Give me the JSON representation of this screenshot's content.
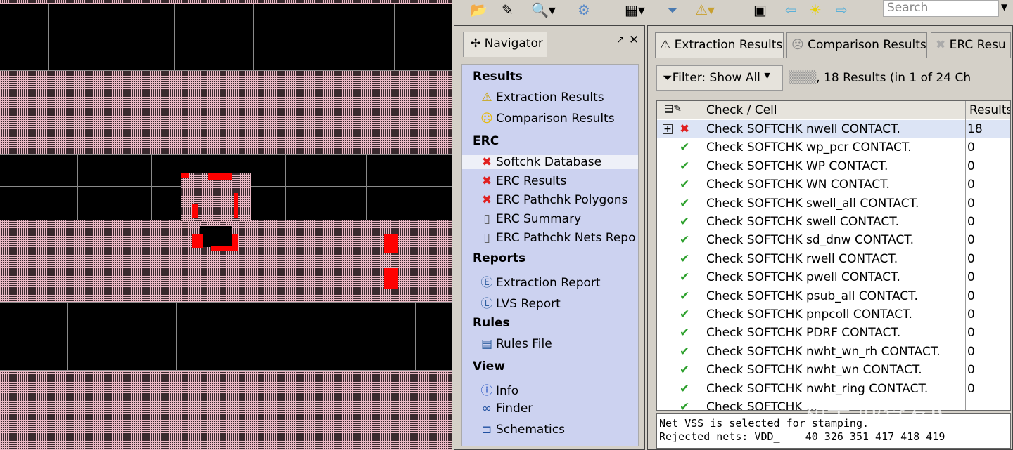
{
  "toolbar": {
    "search_placeholder": "Search"
  },
  "navigator": {
    "tab_label": "Navigator",
    "sections": [
      {
        "title": "Results",
        "items": [
          {
            "icon": "extraction-icon",
            "label": "Extraction Results"
          },
          {
            "icon": "sad-face-icon",
            "label": "Comparison Results"
          }
        ]
      },
      {
        "title": "ERC",
        "items": [
          {
            "icon": "red-x-icon",
            "label": "Softchk Database"
          },
          {
            "icon": "red-x-icon",
            "label": "ERC Results"
          },
          {
            "icon": "red-x-icon",
            "label": "ERC Pathchk Polygons"
          },
          {
            "icon": "document-icon",
            "label": "ERC Summary"
          },
          {
            "icon": "document-icon",
            "label": "ERC Pathchk Nets Repo"
          }
        ]
      },
      {
        "title": "Reports",
        "items": [
          {
            "icon": "report-e-icon",
            "label": "Extraction Report"
          },
          {
            "icon": "report-l-icon",
            "label": "LVS Report"
          }
        ]
      },
      {
        "title": "Rules",
        "items": [
          {
            "icon": "rules-file-icon",
            "label": "Rules File"
          }
        ]
      },
      {
        "title": "View",
        "items": [
          {
            "icon": "info-icon",
            "label": "Info"
          },
          {
            "icon": "binoculars-icon",
            "label": "Finder"
          },
          {
            "icon": "schematic-icon",
            "label": "Schematics"
          }
        ]
      }
    ]
  },
  "tabs": [
    "Extraction Results",
    "Comparison Results",
    "ERC Resu"
  ],
  "filter": {
    "label": "Filter: Show All",
    "summary": ", 18 Results (in 1 of 24 Ch"
  },
  "table": {
    "headers": [
      "Check / Cell",
      "Results"
    ],
    "rows": [
      {
        "status": "error",
        "check": "Check SOFTCHK nwell CONTACT.",
        "results": "18"
      },
      {
        "status": "ok",
        "check": "Check SOFTCHK wp_pcr CONTACT.",
        "results": "0"
      },
      {
        "status": "ok",
        "check": "Check SOFTCHK WP CONTACT.",
        "results": "0"
      },
      {
        "status": "ok",
        "check": "Check SOFTCHK WN CONTACT.",
        "results": "0"
      },
      {
        "status": "ok",
        "check": "Check SOFTCHK swell_all CONTACT.",
        "results": "0"
      },
      {
        "status": "ok",
        "check": "Check SOFTCHK swell CONTACT.",
        "results": "0"
      },
      {
        "status": "ok",
        "check": "Check SOFTCHK sd_dnw CONTACT.",
        "results": "0"
      },
      {
        "status": "ok",
        "check": "Check SOFTCHK rwell CONTACT.",
        "results": "0"
      },
      {
        "status": "ok",
        "check": "Check SOFTCHK pwell CONTACT.",
        "results": "0"
      },
      {
        "status": "ok",
        "check": "Check SOFTCHK psub_all CONTACT.",
        "results": "0"
      },
      {
        "status": "ok",
        "check": "Check SOFTCHK pnpcoll CONTACT.",
        "results": "0"
      },
      {
        "status": "ok",
        "check": "Check SOFTCHK PDRF CONTACT.",
        "results": "0"
      },
      {
        "status": "ok",
        "check": "Check SOFTCHK nwht_wn_rh CONTACT.",
        "results": "0"
      },
      {
        "status": "ok",
        "check": "Check SOFTCHK nwht_wn CONTACT.",
        "results": "0"
      },
      {
        "status": "ok",
        "check": "Check SOFTCHK nwht_ring CONTACT.",
        "results": "0"
      },
      {
        "status": "ok",
        "check": "Check SOFTCHK ...",
        "results": ""
      }
    ]
  },
  "log": [
    "Net VSS is selected for stamping.",
    "Rejected nets: VDD_    40 326 351 417 418 419"
  ],
  "watermark": "知乎 @香爱IC"
}
